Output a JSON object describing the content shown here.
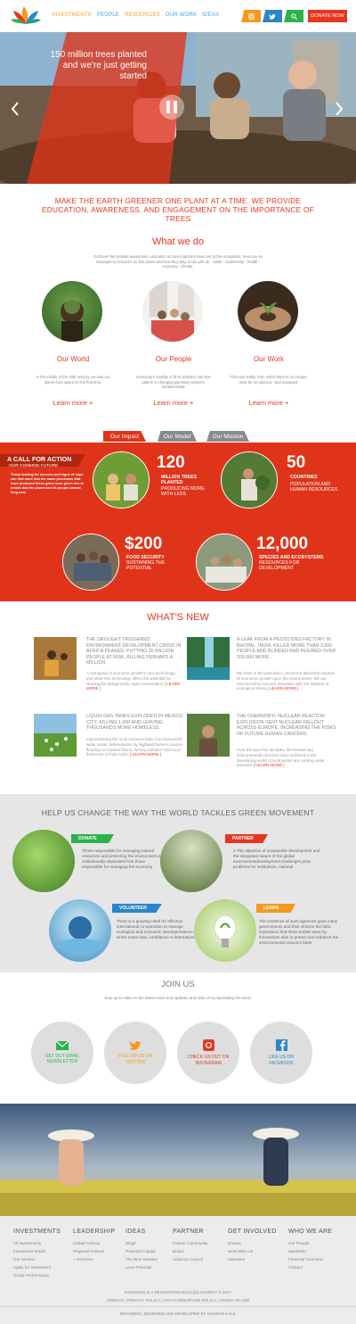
{
  "header": {
    "nav": [
      "INVESTMENTS",
      "PEOPLE",
      "RESOURCES",
      "OUR WORK",
      "IDEAS"
    ],
    "nav_colors": [
      "#f7a21b",
      "#3aa7de",
      "#f7a21b",
      "#3aa7de",
      "#3aa7de"
    ],
    "donate_label": "DONATE NOW",
    "social_icons": [
      "instagram-icon",
      "twitter-icon",
      "search-icon"
    ]
  },
  "hero": {
    "caption": "150 million trees planted and we're just getting started"
  },
  "intro": {
    "tagline": "MAKE THE EARTH GREENER ONE PLANT AT A TIME. WE PROVIDE EDUCATION, AWARENESS, AND ENGAGEMENT ON THE IMPORTANCE OF TREES",
    "heading": "What we do",
    "text": "GoGreen We provide awareness, education on how important trees are to the ecosystem. trees are so important to everyone on this planet and how they play a role with air - water - biodiversity - health - economy - climate."
  },
  "columns": [
    {
      "title": "Our World",
      "text": "In the middle of the 20th century, we saw our planet from space for the first time.",
      "more": "Learn more +"
    },
    {
      "title": "Our People",
      "text": "Humanity's inability to fit its activities into that pattern is changing planetary systems, fundamentally.",
      "more": "Learn more +"
    },
    {
      "title": "Our Work",
      "text": "This new reality, from which there is no escape, must be recognized - and managed.",
      "more": "Learn more +"
    }
  ],
  "impact": {
    "tabs": [
      "Our Impact",
      "Our Model",
      "Our Mission"
    ],
    "call_title": "A CALL FOR ACTION",
    "call_sub": "OUR COMMON FUTURE",
    "call_text": "Those looking for success and signs of hope can find more that the same processes that have produced these gains have given rise to trends that the planet and its people cannot long bear",
    "stats": [
      {
        "num": "120",
        "line1": "MILLION TREES PLANTED",
        "line2": "PRODUCING MORE WITH LESS"
      },
      {
        "num": "50",
        "line1": "COUNTRIES",
        "line2": "POPULATION AND HUMAN RESOURCES"
      },
      {
        "num": "$200",
        "line1": "FOOD SECURITY",
        "line2": "SUSTAINING THE POTENTIAL"
      },
      {
        "num": "12,000",
        "line1": "SPECIES AND ECOSYSTEMS",
        "line2": "RESOURCES FOR DEVELOPMENT"
      }
    ]
  },
  "news": {
    "heading": "WHAT'S NEW",
    "items": [
      {
        "title": "THE DROUGHT TRIGGERED, ENVIRONMENT-DEVELOPMENT CRISIS IN AFRICA PEAKED, PUTTING 36 MILLION PEOPLE AT RISK, KILLING PERHAPS A MILLION.",
        "text": "A reshaping of economic growth's new technology, and while this technology offers the potential for slowing the dangerously rapid consumption",
        "more": "[ LEARN MORE ]"
      },
      {
        "title": "A LEAK FROM A PESTICIDES FACTORY IN BHOPAL, INDIA, KILLED MORE THAN 2,000 PEOPLE AND BLINDED AND INJURED OVER 200,000 MORE.",
        "text": "We have in the past been concerned about the impacts of economic growth upon the environment. We are now forced to concern ourselves with the impacts of ecological stress",
        "more": "[ LEARN MORE ]"
      },
      {
        "title": "LIQUID GAS TANKS EXPLODED IN MEXICO CITY, KILLING 1,000 AND LEAVING THOUSANDS MORE HOMELESS.",
        "text": "Impoverishing the local resource base can impoverish wider areas: deforestation by highland farmers causes flooding on lowland farms; factory pollution robs local fishermen of their catch.",
        "more": "[ LEARN MORE ]"
      },
      {
        "title": "THE CHERNOBYL NUCLEAR REACTOR EXPLOSION SENT NUCLEAR FALLOUT ACROSS EUROPE, INCREASING THE RISKS OF FUTURE HUMAN CANCERS.",
        "text": "Over the past few decades, life-threatening environmental concerns have surfaced in the developing world. Countrysides are coming under pressure",
        "more": "[ LEARN MORE ]"
      }
    ]
  },
  "help": {
    "heading": "HELP US CHANGE THE WAY THE WORLD TACKLES GREEN MOVEMENT",
    "items": [
      {
        "tag": "DONATE",
        "color": "#2bb34a",
        "text": "Those responsible for managing natural resources and protecting the environment are institutionally separated from those responsible for managing the economy."
      },
      {
        "tag": "PARTNER",
        "color": "#e8361e",
        "text": "A The objective of sustainable development and the integrated nature of the global environment/development challenges pose problems for institutions, national"
      },
      {
        "tag": "VOLUNTEER",
        "color": "#2a86c8",
        "text": "There is a growing need for effective international co-operation to manage ecological and economic interdependence. Yet at the same time, confidence in international"
      },
      {
        "tag": "LEARN",
        "color": "#f39a1f",
        "text": "The existence of such agencies gave many governments and their citizens the false impression that these bodies were by themselves able to protect and enhance the environmental resource base"
      }
    ]
  },
  "join": {
    "heading": "JOIN US",
    "sub": "Stay up-to-date on the latest news and updates and help us by spreading the word.",
    "items": [
      {
        "label": "GET OUT EMAIL NEWSLETTER",
        "icon": "email-icon",
        "color": "#2bb34a"
      },
      {
        "label": "FOLLOW US ON TWITTER",
        "icon": "twitter-icon",
        "color": "#f39a1f"
      },
      {
        "label": "CHECK US OUT ON INSTAGRAM",
        "icon": "instagram-icon",
        "color": "#e8361e"
      },
      {
        "label": "LIKE US ON FACEBOOK",
        "icon": "facebook-icon",
        "color": "#2a86c8"
      }
    ]
  },
  "footer": {
    "columns": [
      {
        "head": "INVESTMENTS",
        "items": [
          "All Investments",
          "Investment Model",
          "Our Sectors",
          "Apply for Investment",
          "Social Performance"
        ]
      },
      {
        "head": "LEADERSHIP",
        "items": [
          "Global Fellows",
          "Regional Fellows",
          "+ GoGreen"
        ]
      },
      {
        "head": "IDEAS",
        "items": [
          "Blogs",
          "Potential Capital",
          "The Blue Sweater",
          "Lean Potential"
        ]
      },
      {
        "head": "PARTNER",
        "items": [
          "Partner Community",
          "Board",
          "Advisory Council"
        ]
      },
      {
        "head": "GET INVOLVED",
        "items": [
          "Donate",
          "Work With Us",
          "Volunteer"
        ]
      },
      {
        "head": "WHO WE ARE",
        "items": [
          "Our People",
          "Manifesto",
          "Financial Overview",
          "Contact"
        ]
      }
    ],
    "line1": "GOGREEN IS A REGISTERED 501(C)(3) CHARITY © 2017",
    "line2": "CREDITS | PRIVACY POLICY | ANTI-CORRUPTION POLICY | TERMS OF USE",
    "line3": "BRANDING, DESIGNED AND DEVELOPED BY KONRAD KALE"
  }
}
